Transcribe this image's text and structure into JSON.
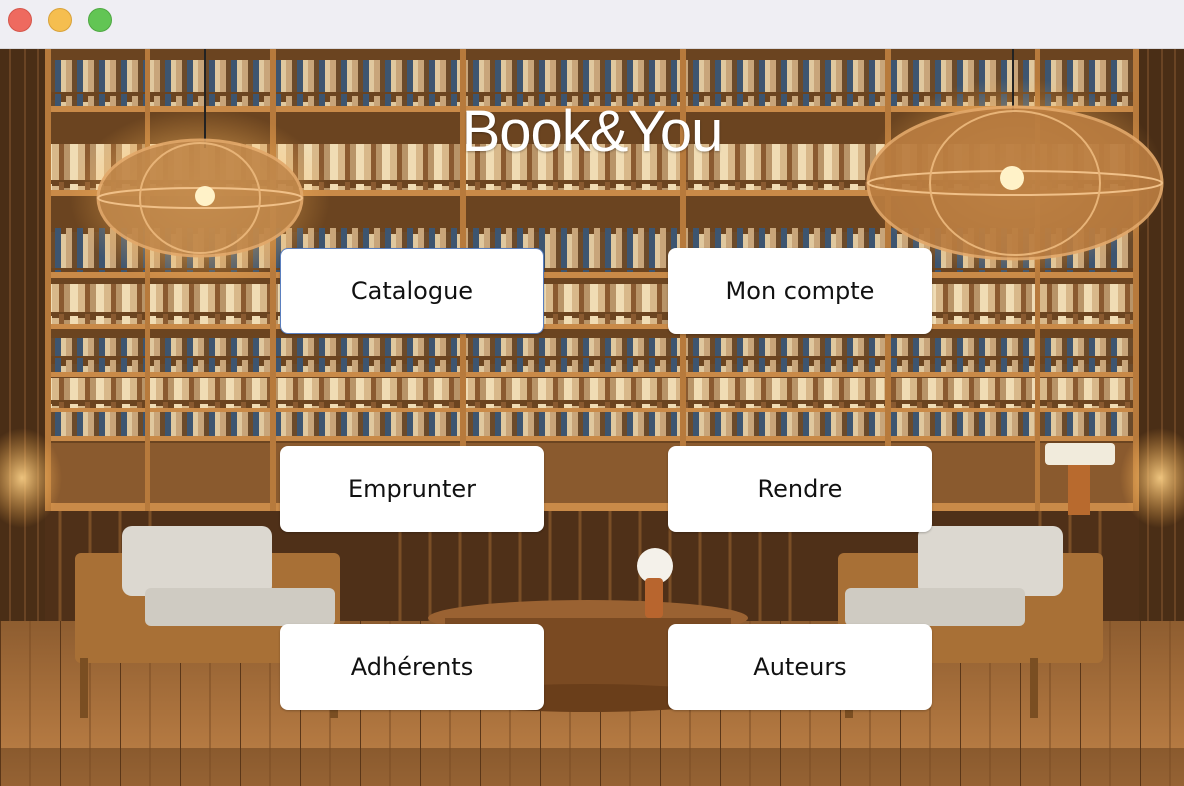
{
  "window": {
    "controls": [
      "close",
      "minimize",
      "zoom"
    ]
  },
  "app": {
    "title": "Book&You"
  },
  "menu": {
    "catalogue": "Catalogue",
    "mon_compte": "Mon compte",
    "emprunter": "Emprunter",
    "rendre": "Rendre",
    "adherents": "Adhérents",
    "auteurs": "Auteurs"
  },
  "colors": {
    "close": "#ee6a5f",
    "minimize": "#f5be4f",
    "zoom": "#62c554",
    "button_bg": "#ffffff",
    "focus_border": "#5a7fbf"
  }
}
